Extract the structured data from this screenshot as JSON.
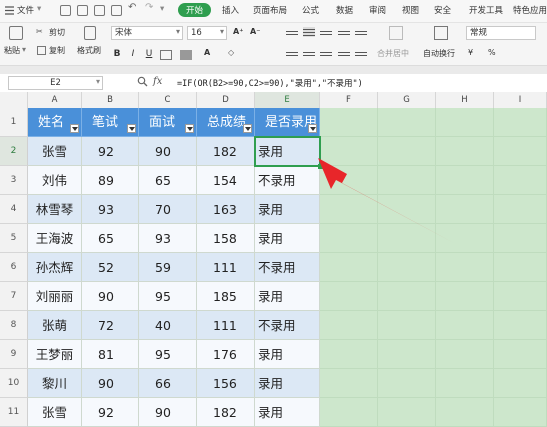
{
  "menubar": {
    "file": "文件",
    "tabs": [
      "开始",
      "插入",
      "页面布局",
      "公式",
      "数据",
      "审阅",
      "视图",
      "安全",
      "开发工具",
      "特色应用"
    ],
    "active_tab": "开始"
  },
  "ribbon": {
    "paste": "粘贴",
    "cut": "剪切",
    "copy": "复制",
    "format_painter": "格式刷",
    "font_name": "宋体",
    "font_size": "16",
    "font_grow": "A⁺",
    "font_shrink": "A⁻",
    "bold": "B",
    "italic": "I",
    "underline": "U",
    "merge_center": "合并居中",
    "wrap_text": "自动换行",
    "number_format": "常规",
    "currency": "¥",
    "percent": "%"
  },
  "formula_bar": {
    "name_box": "E2",
    "zoom_icon": "magnifier-icon",
    "fx": "fx",
    "formula": "=IF(OR(B2>=90,C2>=90),\"录用\",\"不录用\")"
  },
  "grid": {
    "column_headers": [
      "A",
      "B",
      "C",
      "D",
      "E",
      "F",
      "G",
      "H",
      "I"
    ],
    "selected_column": "E",
    "row_headers": [
      "1",
      "2",
      "3",
      "4",
      "5",
      "6",
      "7",
      "8",
      "9",
      "10",
      "11"
    ],
    "selected_row": "2",
    "selected_cell": "E2",
    "table_header": [
      "姓名",
      "笔试",
      "面试",
      "总成绩",
      "是否录用"
    ],
    "rows": [
      [
        "张雪",
        "92",
        "90",
        "182",
        "录用"
      ],
      [
        "刘伟",
        "89",
        "65",
        "154",
        "不录用"
      ],
      [
        "林雪琴",
        "93",
        "70",
        "163",
        "录用"
      ],
      [
        "王海波",
        "65",
        "93",
        "158",
        "录用"
      ],
      [
        "孙杰辉",
        "52",
        "59",
        "111",
        "不录用"
      ],
      [
        "刘丽丽",
        "90",
        "95",
        "185",
        "录用"
      ],
      [
        "张萌",
        "72",
        "40",
        "111",
        "不录用"
      ],
      [
        "王梦丽",
        "81",
        "95",
        "176",
        "录用"
      ],
      [
        "黎川",
        "90",
        "66",
        "156",
        "录用"
      ],
      [
        "张雪",
        "92",
        "90",
        "182",
        "录用"
      ]
    ]
  },
  "colors": {
    "accent_green": "#2f9e4f",
    "header_blue": "#4a90d9",
    "row_light_blue": "#dce8f5",
    "sheet_green": "#cde7cc",
    "arrow_red": "#e8262a"
  }
}
